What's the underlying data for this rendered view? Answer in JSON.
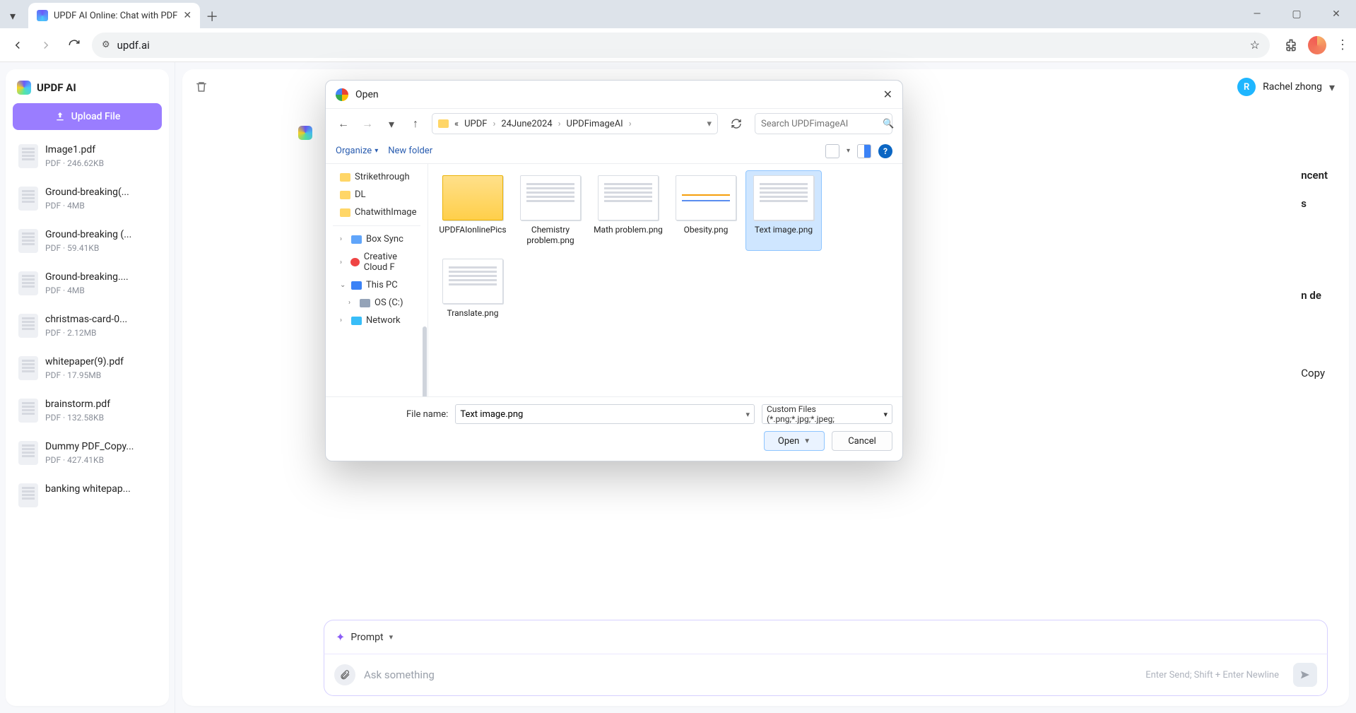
{
  "browser": {
    "tab_title": "UPDF AI Online: Chat with PDF",
    "url": "updf.ai"
  },
  "app": {
    "brand": "UPDF AI",
    "upload_label": "Upload File",
    "user": {
      "initial": "R",
      "name": "Rachel zhong"
    },
    "files": [
      {
        "name": "Image1.pdf",
        "meta": "PDF · 246.62KB"
      },
      {
        "name": "Ground-breaking(...",
        "meta": "PDF · 4MB"
      },
      {
        "name": "Ground-breaking (...",
        "meta": "PDF · 59.41KB"
      },
      {
        "name": "Ground-breaking....",
        "meta": "PDF · 4MB"
      },
      {
        "name": "christmas-card-0...",
        "meta": "PDF · 2.12MB"
      },
      {
        "name": "whitepaper(9).pdf",
        "meta": "PDF · 17.95MB"
      },
      {
        "name": "brainstorm.pdf",
        "meta": "PDF · 132.58KB"
      },
      {
        "name": "Dummy PDF_Copy...",
        "meta": "PDF · 427.41KB"
      },
      {
        "name": "banking whitepap...",
        "meta": ""
      }
    ],
    "prompt": {
      "label": "Prompt",
      "placeholder": "Ask something",
      "hint": "Enter Send; Shift + Enter Newline"
    },
    "content_snips": {
      "l1": "ncent",
      "l2": "s",
      "l3": "n de",
      "copy": "Copy"
    }
  },
  "dialog": {
    "title": "Open",
    "breadcrumb": {
      "prefix": "«",
      "p1": "UPDF",
      "p2": "24June2024",
      "p3": "UPDFimageAI"
    },
    "search_placeholder": "Search UPDFimageAI",
    "organize": "Organize",
    "new_folder": "New folder",
    "tree": {
      "strikethrough": "Strikethrough",
      "dl": "DL",
      "chatwithimage": "ChatwithImage",
      "boxsync": "Box Sync",
      "creative": "Creative Cloud F",
      "thispc": "This PC",
      "osc": "OS (C:)",
      "network": "Network"
    },
    "grid": [
      {
        "label": "UPDFAIonlinePics",
        "kind": "folder"
      },
      {
        "label": "Chemistry problem.png",
        "kind": "text"
      },
      {
        "label": "Math problem.png",
        "kind": "text"
      },
      {
        "label": "Obesity.png",
        "kind": "chart"
      },
      {
        "label": "Text image.png",
        "kind": "text",
        "selected": true
      },
      {
        "label": "Translate.png",
        "kind": "text"
      }
    ],
    "fname_label": "File name:",
    "fname_value": "Text image.png",
    "ftype": "Custom Files (*.png;*.jpg;*.jpeg;",
    "open": "Open",
    "cancel": "Cancel"
  }
}
